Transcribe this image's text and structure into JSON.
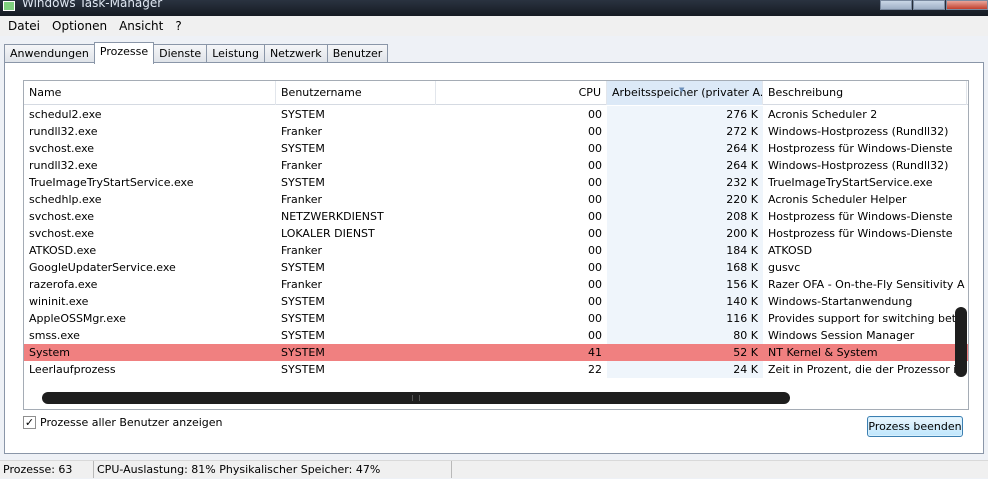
{
  "window": {
    "title": "Windows Task-Manager"
  },
  "menu": [
    "Datei",
    "Optionen",
    "Ansicht",
    "?"
  ],
  "tabs": [
    {
      "label": "Anwendungen"
    },
    {
      "label": "Prozesse",
      "active": true
    },
    {
      "label": "Dienste"
    },
    {
      "label": "Leistung"
    },
    {
      "label": "Netzwerk"
    },
    {
      "label": "Benutzer"
    }
  ],
  "columns": {
    "name": "Name",
    "user": "Benutzername",
    "cpu": "CPU",
    "mem": "Arbeitsspeicher (privater A...",
    "desc": "Beschreibung"
  },
  "rows": [
    {
      "name": "schedul2.exe",
      "user": "SYSTEM",
      "cpu": "00",
      "mem": "276 K",
      "desc": "Acronis Scheduler 2"
    },
    {
      "name": "rundll32.exe",
      "user": "Franker",
      "cpu": "00",
      "mem": "272 K",
      "desc": "Windows-Hostprozess (Rundll32)"
    },
    {
      "name": "svchost.exe",
      "user": "SYSTEM",
      "cpu": "00",
      "mem": "264 K",
      "desc": "Hostprozess für Windows-Dienste"
    },
    {
      "name": "rundll32.exe",
      "user": "Franker",
      "cpu": "00",
      "mem": "264 K",
      "desc": "Windows-Hostprozess (Rundll32)"
    },
    {
      "name": "TrueImageTryStartService.exe",
      "user": "SYSTEM",
      "cpu": "00",
      "mem": "232 K",
      "desc": "TrueImageTryStartService.exe"
    },
    {
      "name": "schedhlp.exe",
      "user": "Franker",
      "cpu": "00",
      "mem": "220 K",
      "desc": "Acronis Scheduler Helper"
    },
    {
      "name": "svchost.exe",
      "user": "NETZWERKDIENST",
      "cpu": "00",
      "mem": "208 K",
      "desc": "Hostprozess für Windows-Dienste"
    },
    {
      "name": "svchost.exe",
      "user": "LOKALER DIENST",
      "cpu": "00",
      "mem": "200 K",
      "desc": "Hostprozess für Windows-Dienste"
    },
    {
      "name": "ATKOSD.exe",
      "user": "Franker",
      "cpu": "00",
      "mem": "184 K",
      "desc": "ATKOSD"
    },
    {
      "name": "GoogleUpdaterService.exe",
      "user": "SYSTEM",
      "cpu": "00",
      "mem": "168 K",
      "desc": "gusvc"
    },
    {
      "name": "razerofa.exe",
      "user": "Franker",
      "cpu": "00",
      "mem": "156 K",
      "desc": "Razer OFA - On-the-Fly Sensitivity A"
    },
    {
      "name": "wininit.exe",
      "user": "SYSTEM",
      "cpu": "00",
      "mem": "140 K",
      "desc": "Windows-Startanwendung"
    },
    {
      "name": "AppleOSSMgr.exe",
      "user": "SYSTEM",
      "cpu": "00",
      "mem": "116 K",
      "desc": "Provides support for switching betw"
    },
    {
      "name": "smss.exe",
      "user": "SYSTEM",
      "cpu": "00",
      "mem": "80 K",
      "desc": "Windows Session Manager"
    },
    {
      "name": "System",
      "user": "SYSTEM",
      "cpu": "41",
      "mem": "52 K",
      "desc": "NT Kernel & System",
      "selected": true
    },
    {
      "name": "Leerlaufprozess",
      "user": "SYSTEM",
      "cpu": "22",
      "mem": "24 K",
      "desc": "Zeit in Prozent, die der Prozessor im"
    }
  ],
  "show_all_users": {
    "label": "Prozesse aller Benutzer anzeigen",
    "checked": true,
    "mark": "✓"
  },
  "end_process_label": "Prozess beenden",
  "status": {
    "processes": "Prozesse: 63",
    "cpu": "CPU-Auslastung: 81%",
    "memory": "Physikalischer Speicher: 47%"
  },
  "colors": {
    "selected_row": "#f08080",
    "sorted_column": "#dce9f7"
  }
}
